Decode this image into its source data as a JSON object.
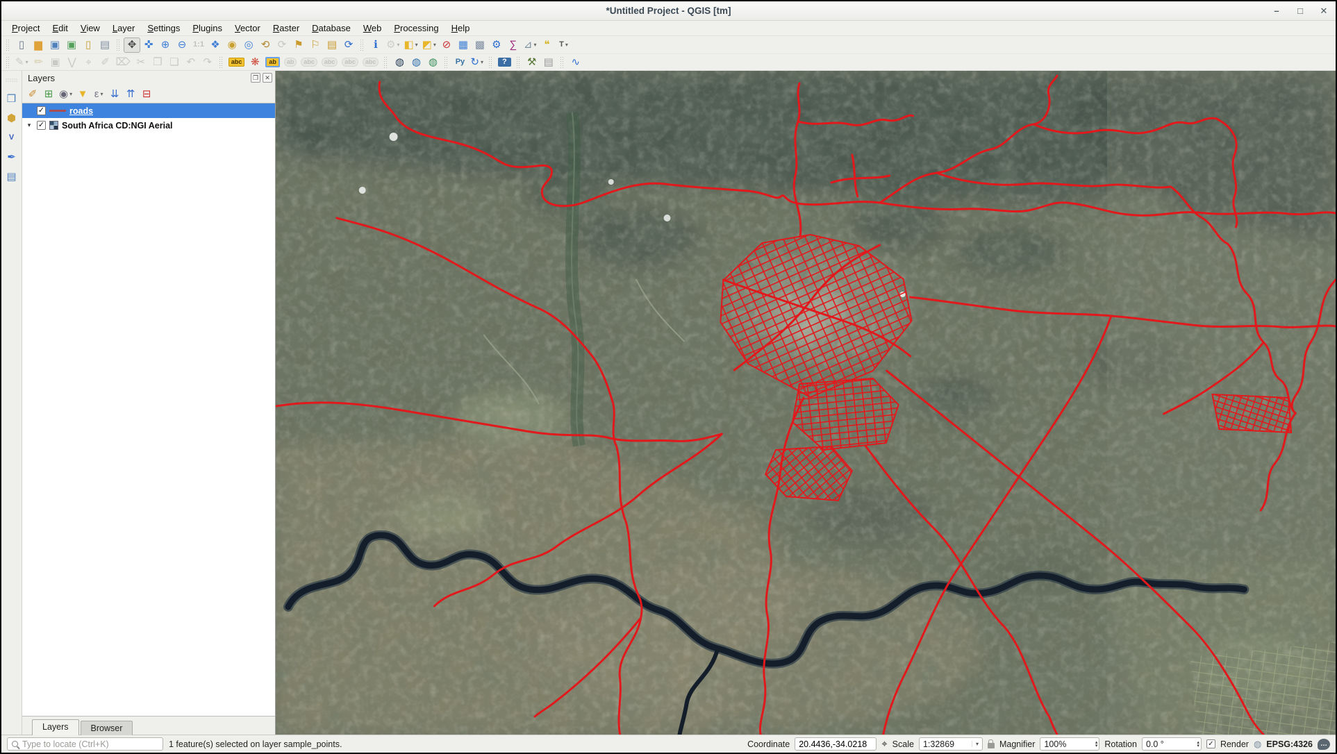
{
  "window": {
    "title": "*Untitled Project - QGIS [tm]",
    "controls": [
      {
        "name": "minimize-button",
        "icon": "minimize-icon",
        "glyph": "–"
      },
      {
        "name": "maximize-button",
        "icon": "maximize-icon",
        "glyph": "□"
      },
      {
        "name": "close-button",
        "icon": "close-icon",
        "glyph": "✕"
      }
    ]
  },
  "menubar": {
    "items": [
      {
        "name": "menu-project",
        "label": "Project"
      },
      {
        "name": "menu-edit",
        "label": "Edit"
      },
      {
        "name": "menu-view",
        "label": "View"
      },
      {
        "name": "menu-layer",
        "label": "Layer"
      },
      {
        "name": "menu-settings",
        "label": "Settings"
      },
      {
        "name": "menu-plugins",
        "label": "Plugins"
      },
      {
        "name": "menu-vector",
        "label": "Vector"
      },
      {
        "name": "menu-raster",
        "label": "Raster"
      },
      {
        "name": "menu-database",
        "label": "Database"
      },
      {
        "name": "menu-web",
        "label": "Web"
      },
      {
        "name": "menu-processing",
        "label": "Processing"
      },
      {
        "name": "menu-help",
        "label": "Help"
      }
    ]
  },
  "toolbar_row1": {
    "buttons": [
      {
        "sep": true
      },
      {
        "name": "new-project-button",
        "icon": "new-project-icon",
        "glyph": "▯",
        "color": "#6b7b8d"
      },
      {
        "name": "open-project-button",
        "icon": "open-folder-icon",
        "glyph": "▆",
        "color": "#e0a33c"
      },
      {
        "name": "save-project-button",
        "icon": "save-icon",
        "glyph": "▣",
        "color": "#4f81bd"
      },
      {
        "name": "save-project-as-button",
        "icon": "save-as-icon",
        "glyph": "▣",
        "color": "#53a05a"
      },
      {
        "name": "new-print-layout-button",
        "icon": "print-layout-icon",
        "glyph": "▯",
        "color": "#caa03a"
      },
      {
        "name": "show-layout-manager-button",
        "icon": "layout-manager-icon",
        "glyph": "▤",
        "color": "#7d8da0"
      },
      {
        "sep": true
      },
      {
        "name": "pan-map-button",
        "icon": "pan-hand-icon",
        "glyph": "✥",
        "color": "#4a4a4a",
        "state": "active"
      },
      {
        "name": "pan-to-selection-button",
        "icon": "pan-selection-icon",
        "glyph": "✜",
        "color": "#3f7fd6"
      },
      {
        "name": "zoom-in-button",
        "icon": "zoom-in-icon",
        "glyph": "⊕",
        "color": "#3f7fd6"
      },
      {
        "name": "zoom-out-button",
        "icon": "zoom-out-icon",
        "glyph": "⊖",
        "color": "#3f7fd6"
      },
      {
        "name": "zoom-native-button",
        "icon": "zoom-native-icon",
        "glyph": "1:1",
        "cls": "txt",
        "color": "#888",
        "state": "disabled"
      },
      {
        "name": "zoom-full-button",
        "icon": "zoom-full-icon",
        "glyph": "❖",
        "color": "#3f7fd6"
      },
      {
        "name": "zoom-to-selection-button",
        "icon": "zoom-selection-icon",
        "glyph": "◉",
        "color": "#c9a02e"
      },
      {
        "name": "zoom-to-layer-button",
        "icon": "zoom-layer-icon",
        "glyph": "◎",
        "color": "#3f7fd6"
      },
      {
        "name": "zoom-last-button",
        "icon": "zoom-last-icon",
        "glyph": "⟲",
        "color": "#b08830"
      },
      {
        "name": "zoom-next-button",
        "icon": "zoom-next-icon",
        "glyph": "⟳",
        "color": "#999",
        "state": "disabled"
      },
      {
        "name": "new-bookmark-button",
        "icon": "bookmark-add-icon",
        "glyph": "⚑",
        "color": "#c99b2e"
      },
      {
        "name": "show-bookmarks-button",
        "icon": "bookmarks-icon",
        "glyph": "⚐",
        "color": "#c99b2e"
      },
      {
        "name": "bookmark-manager-button",
        "icon": "bookmark-manager-icon",
        "glyph": "▤",
        "color": "#c99b2e"
      },
      {
        "name": "refresh-map-button",
        "icon": "refresh-icon",
        "glyph": "⟳",
        "color": "#2f6fd0"
      },
      {
        "sep": true
      },
      {
        "name": "identify-features-button",
        "icon": "identify-icon",
        "glyph": "ℹ",
        "color": "#2f6fd0"
      },
      {
        "name": "run-feature-action-button",
        "icon": "feature-action-icon",
        "glyph": "⚙",
        "color": "#a8a8a8",
        "state": "disabled",
        "dropdown": "▾"
      },
      {
        "name": "select-features-button",
        "icon": "select-rectangle-icon",
        "glyph": "◧",
        "color": "#e8b62a",
        "dropdown": "▾"
      },
      {
        "name": "select-by-form-button",
        "icon": "select-form-icon",
        "glyph": "◩",
        "color": "#e8b62a",
        "dropdown": "▾"
      },
      {
        "name": "deselect-all-button",
        "icon": "deselect-icon",
        "glyph": "⊘",
        "color": "#cc3333"
      },
      {
        "name": "open-attribute-table-button",
        "icon": "attribute-table-icon",
        "glyph": "▦",
        "color": "#3f7fd6"
      },
      {
        "name": "field-calculator-button",
        "icon": "field-calculator-icon",
        "glyph": "▩",
        "color": "#7d8da0"
      },
      {
        "name": "processing-toolbox-button",
        "icon": "processing-gear-icon",
        "glyph": "⚙",
        "color": "#2f6fd0"
      },
      {
        "name": "statistics-button",
        "icon": "sum-icon",
        "glyph": "∑",
        "color": "#a0267e"
      },
      {
        "name": "measure-button",
        "icon": "measure-icon",
        "glyph": "⊿",
        "color": "#7d8da0",
        "dropdown": "▾"
      },
      {
        "name": "map-tips-button",
        "icon": "map-tips-icon",
        "glyph": "❝",
        "color": "#d8b62a"
      },
      {
        "name": "text-annotation-button",
        "icon": "text-annotation-icon",
        "glyph": "T",
        "cls": "txt",
        "color": "#555",
        "dropdown": "▾"
      }
    ]
  },
  "toolbar_row2": {
    "buttons": [
      {
        "sep": true
      },
      {
        "name": "current-edits-button",
        "icon": "current-edits-icon",
        "glyph": "✎",
        "color": "#9a9a9a",
        "state": "disabled",
        "dropdown": "▾"
      },
      {
        "name": "toggle-editing-button",
        "icon": "toggle-editing-icon",
        "glyph": "✏",
        "color": "#b9a95e",
        "state": "disabled"
      },
      {
        "name": "save-layer-edits-button",
        "icon": "save-edits-icon",
        "glyph": "▣",
        "color": "#9a9a9a",
        "state": "disabled"
      },
      {
        "name": "add-feature-button",
        "icon": "add-feature-icon",
        "glyph": "⋁",
        "color": "#9a9a9a",
        "state": "disabled"
      },
      {
        "name": "vertex-tool-button",
        "icon": "vertex-tool-icon",
        "glyph": "⌖",
        "color": "#9a9a9a",
        "state": "disabled"
      },
      {
        "name": "modify-attributes-button",
        "icon": "modify-attributes-icon",
        "glyph": "✐",
        "color": "#9a9a9a",
        "state": "disabled"
      },
      {
        "name": "delete-selected-button",
        "icon": "trash-icon",
        "glyph": "⌦",
        "color": "#9a9a9a",
        "state": "disabled"
      },
      {
        "name": "cut-features-button",
        "icon": "cut-icon",
        "glyph": "✂",
        "color": "#9a9a9a",
        "state": "disabled"
      },
      {
        "name": "copy-features-button",
        "icon": "copy-icon",
        "glyph": "❐",
        "color": "#9a9a9a",
        "state": "disabled"
      },
      {
        "name": "paste-features-button",
        "icon": "paste-icon",
        "glyph": "❏",
        "color": "#9a9a9a",
        "state": "disabled"
      },
      {
        "name": "undo-button",
        "icon": "undo-icon",
        "glyph": "↶",
        "color": "#9a9a9a",
        "state": "disabled"
      },
      {
        "name": "redo-button",
        "icon": "redo-icon",
        "glyph": "↷",
        "color": "#9a9a9a",
        "state": "disabled"
      },
      {
        "sep": true
      },
      {
        "name": "layer-labeling-button",
        "icon": "labeling-abc-icon",
        "glyph": "abc",
        "cls": "pill-yellow"
      },
      {
        "name": "layer-diagram-button",
        "icon": "diagram-icon",
        "glyph": "❋",
        "color": "#cf4f3e"
      },
      {
        "name": "highlight-labels-button",
        "icon": "highlight-labels-icon",
        "glyph": "ab",
        "cls": "pill-frame"
      },
      {
        "name": "pin-labels-button",
        "icon": "pin-labels-icon",
        "glyph": "ab",
        "cls": "pill-gray",
        "state": "disabled"
      },
      {
        "name": "show-hide-labels-button",
        "icon": "show-labels-icon",
        "glyph": "abc",
        "cls": "pill-gray",
        "state": "disabled"
      },
      {
        "name": "move-label-button",
        "icon": "move-label-icon",
        "glyph": "abc",
        "cls": "pill-gray",
        "state": "disabled"
      },
      {
        "name": "rotate-label-button",
        "icon": "rotate-label-icon",
        "glyph": "abc",
        "cls": "pill-gray",
        "state": "disabled"
      },
      {
        "name": "change-label-button",
        "icon": "change-label-icon",
        "glyph": "abc",
        "cls": "pill-gray",
        "state": "disabled"
      },
      {
        "sep": true
      },
      {
        "name": "metasearch-button",
        "icon": "metasearch-globe-icon",
        "glyph": "◍",
        "color": "#223a55"
      },
      {
        "name": "add-wms-layer-button",
        "icon": "wms-globe-icon",
        "glyph": "◍",
        "color": "#2e6fae"
      },
      {
        "name": "add-wfs-layer-button",
        "icon": "wfs-globe-icon",
        "glyph": "◍",
        "color": "#3a8f5a"
      },
      {
        "sep": true
      },
      {
        "name": "python-console-button",
        "icon": "python-icon",
        "glyph": "Py",
        "cls": "txt",
        "color": "#3472a4"
      },
      {
        "name": "processing-history-button",
        "icon": "history-icon",
        "glyph": "↻",
        "color": "#2f6fd0",
        "dropdown": "▾"
      },
      {
        "sep": true
      },
      {
        "name": "help-contents-button",
        "icon": "help-icon",
        "glyph": "?",
        "cls": "boxed-blue"
      },
      {
        "sep": true
      },
      {
        "name": "osm-search-button",
        "icon": "tools-hammer-icon",
        "glyph": "⚒",
        "color": "#5a7a3a"
      },
      {
        "name": "notebook-button",
        "icon": "notebook-icon",
        "glyph": "▤",
        "color": "#9a9a9a"
      },
      {
        "sep": true
      },
      {
        "name": "profile-tool-button",
        "icon": "profile-chart-icon",
        "glyph": "∿",
        "color": "#2f6fd0"
      }
    ]
  },
  "side_toolbar": {
    "buttons": [
      {
        "sep": true
      },
      {
        "name": "data-source-manager-button",
        "icon": "data-source-icon",
        "glyph": "❒",
        "color": "#4f81bd"
      },
      {
        "name": "add-spatialite-layer-button",
        "icon": "database-icon",
        "glyph": "⬢",
        "color": "#d2a53a"
      },
      {
        "name": "add-vector-layer-button",
        "icon": "vector-v-icon",
        "glyph": "V",
        "cls": "txt",
        "color": "#3a5fc0"
      },
      {
        "name": "new-shapefile-layer-button",
        "icon": "quill-icon",
        "glyph": "✒",
        "color": "#3a6fd0"
      },
      {
        "name": "add-mesh-layer-button",
        "icon": "mesh-icon",
        "glyph": "▤",
        "color": "#4f81bd"
      }
    ]
  },
  "layers_panel": {
    "title": "Layers",
    "tools": [
      {
        "name": "open-styling-panel-button",
        "icon": "styling-brush-icon",
        "glyph": "✐",
        "color": "#cf8a2e"
      },
      {
        "name": "add-group-button",
        "icon": "add-group-icon",
        "glyph": "⊞",
        "color": "#4a9a4a"
      },
      {
        "name": "manage-map-themes-button",
        "icon": "map-themes-eye-icon",
        "glyph": "◉",
        "color": "#666677",
        "dropdown": "▾"
      },
      {
        "name": "filter-legend-button",
        "icon": "filter-funnel-icon",
        "glyph": "▼",
        "color": "#e8b62a"
      },
      {
        "name": "filter-expression-button",
        "icon": "expression-filter-icon",
        "glyph": "ε",
        "color": "#777788",
        "dropdown": "▾"
      },
      {
        "name": "expand-all-button",
        "icon": "expand-all-icon",
        "glyph": "⇊",
        "color": "#3a6fd0"
      },
      {
        "name": "collapse-all-button",
        "icon": "collapse-all-icon",
        "glyph": "⇈",
        "color": "#3a6fd0"
      },
      {
        "name": "remove-layer-button",
        "icon": "remove-layer-icon",
        "glyph": "⊟",
        "color": "#cc3333"
      }
    ],
    "layers": [
      {
        "label": "roads",
        "checked": true,
        "selected": true
      },
      {
        "label": "South Africa CD:NGI Aerial",
        "checked": true
      }
    ],
    "tabs": [
      {
        "name": "tab-layers",
        "label": "Layers",
        "state": "active"
      },
      {
        "name": "tab-browser",
        "label": "Browser"
      }
    ]
  },
  "statusbar": {
    "locate_placeholder": "Type to locate (Ctrl+K)",
    "message": "1 feature(s) selected on layer sample_points.",
    "coordinate_label": "Coordinate",
    "coordinate_value": "20.4436,-34.0218",
    "scale_label": "Scale",
    "scale_value": "1:32869",
    "magnifier_label": "Magnifier",
    "magnifier_value": "100%",
    "rotation_label": "Rotation",
    "rotation_value": "0.0 °",
    "render_label": "Render",
    "crs_label": "EPSG:4326"
  },
  "glyphs": {
    "checkmark": "✓",
    "dropdown": "▾",
    "spin_up": "▴",
    "spin_down": "▾",
    "expander": "▾",
    "float_panel": "❐",
    "close_panel": "✕",
    "globe": "◍",
    "pointer": "⌖",
    "ellipsis": "…"
  },
  "colors": {
    "selection": "#3e83dd",
    "road": "#e2191c",
    "legend-road": "#a94e55",
    "title-text": "#3b4a55"
  }
}
